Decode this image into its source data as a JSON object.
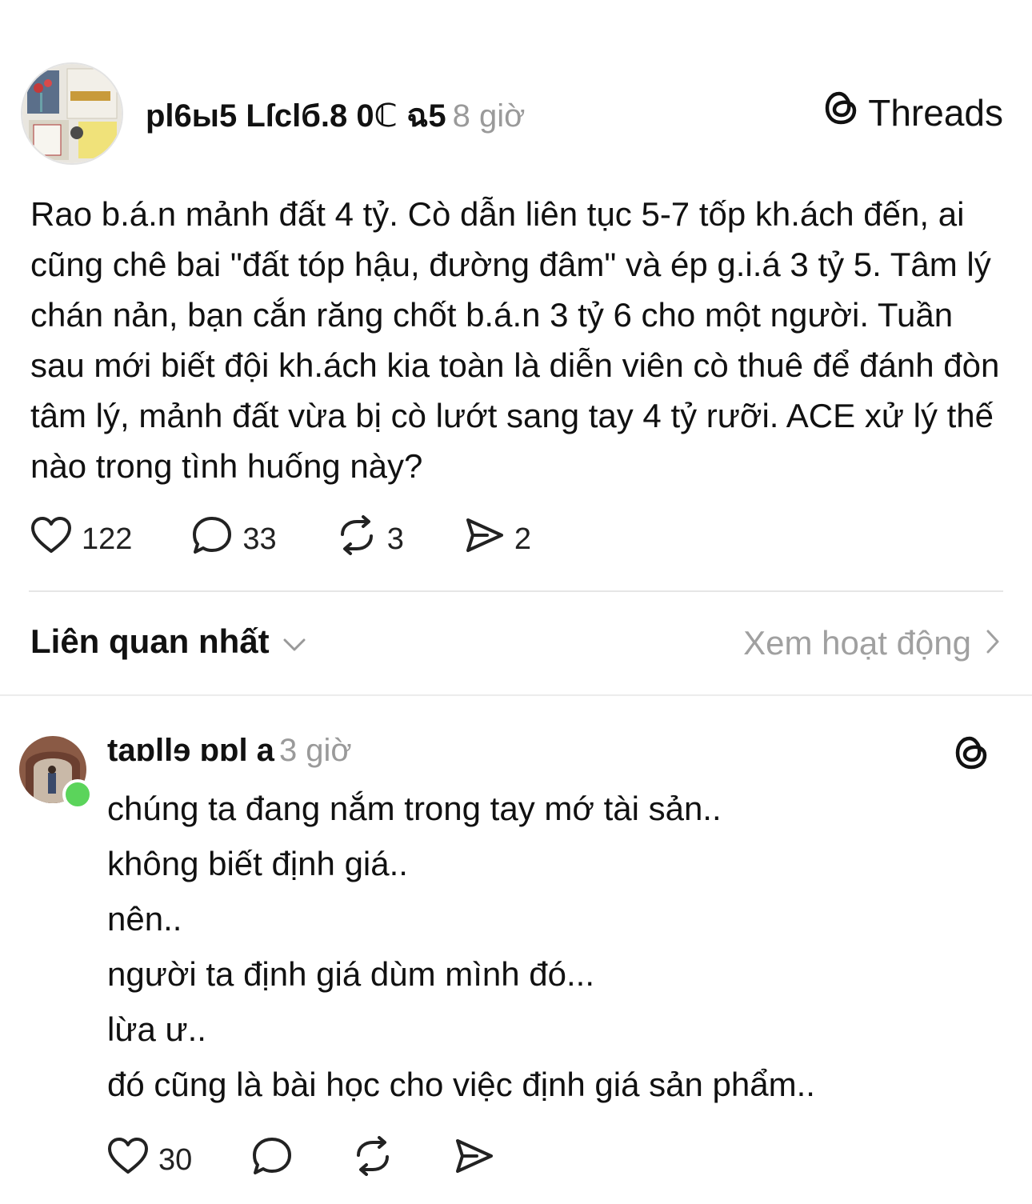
{
  "post": {
    "author": "pl6ы5 Lſclб.8 0ℂ ฉ5",
    "time": "8 giờ",
    "brand": "Threads",
    "text": "Rao b.á.n mảnh đất 4 tỷ. Cò dẫn liên tục 5-7 tốp kh.ách đến, ai cũng chê bai \"đất tóp hậu, đường đâm\" và ép g.i.á 3 tỷ 5. Tâm lý chán nản, bạn cắn răng chốt b.á.n 3 tỷ 6 cho một người. Tuần sau mới biết đội kh.ách kia toàn là diễn viên cò thuê để đánh đòn tâm lý, mảnh đất vừa bị cò lướt sang tay 4 tỷ rưỡi. ACE xử lý thế nào trong tình huống này?",
    "likes": "122",
    "comments": "33",
    "reposts": "3",
    "shares": "2"
  },
  "sort": {
    "label": "Liên quan nhất",
    "activity_link": "Xem hoạt động"
  },
  "reply": {
    "author": "taɒllɘ ɒɒl a",
    "time": "3 giờ",
    "lines": [
      "chúng ta đang nắm trong tay mớ tài sản..",
      "không biết định giá..",
      "nên..",
      "người ta định giá dùm mình đó...",
      "lừa ư..",
      "đó cũng là bài học cho việc định giá sản phẩm.."
    ],
    "likes": "30"
  },
  "icons": {
    "like": "heart-icon",
    "comment": "comment-bubble-icon",
    "repost": "repost-icon",
    "share": "send-icon",
    "brand": "threads-logo-icon",
    "dropdown": "chevron-down-icon",
    "link": "chevron-right-icon"
  },
  "colors": {
    "online": "#5bd45b",
    "muted": "#9a9a9a"
  }
}
